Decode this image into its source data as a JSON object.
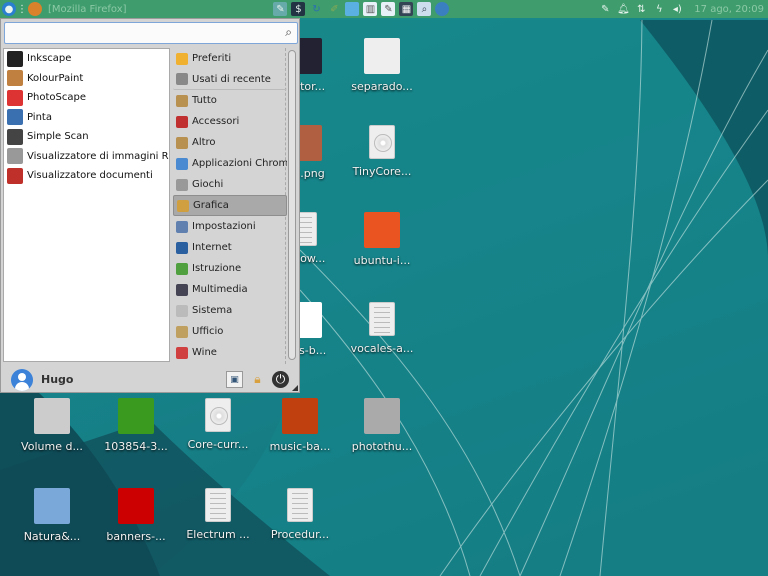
{
  "taskbar": {
    "window_title": "[Mozilla Firefox]",
    "launchers": [
      "menu-icon",
      "firefox-icon",
      "text-editor-icon",
      "terminal-icon",
      "refresh-icon",
      "brush-icon",
      "window-icon",
      "spreadsheet-icon",
      "notes-icon",
      "calculator-icon",
      "search-files-icon",
      "thunderbird-icon"
    ],
    "tray": [
      "notes-icon",
      "bell-icon",
      "network-icon",
      "power-icon",
      "volume-icon"
    ],
    "clock": "17 ago, 20:09"
  },
  "menu": {
    "search_placeholder": "",
    "apps": [
      {
        "label": "Inkscape",
        "color": "#222"
      },
      {
        "label": "KolourPaint",
        "color": "#c08040"
      },
      {
        "label": "PhotoScape",
        "color": "#d33"
      },
      {
        "label": "Pinta",
        "color": "#3a6fb0"
      },
      {
        "label": "Simple Scan",
        "color": "#444"
      },
      {
        "label": "Visualizzatore di immagini Ris...",
        "color": "#999"
      },
      {
        "label": "Visualizzatore documenti",
        "color": "#c0302a"
      }
    ],
    "categories": [
      {
        "label": "Preferiti",
        "color": "#f0b030"
      },
      {
        "label": "Usati di recente",
        "color": "#888"
      },
      {
        "label": "Tutto",
        "color": "#b89050"
      },
      {
        "label": "Accessori",
        "color": "#c03030"
      },
      {
        "label": "Altro",
        "color": "#b89050"
      },
      {
        "label": "Applicazioni Chromium",
        "color": "#4a8ad0"
      },
      {
        "label": "Giochi",
        "color": "#999"
      },
      {
        "label": "Grafica",
        "color": "#d0a040"
      },
      {
        "label": "Impostazioni",
        "color": "#6080b0"
      },
      {
        "label": "Internet",
        "color": "#2a5fa0"
      },
      {
        "label": "Istruzione",
        "color": "#50a040"
      },
      {
        "label": "Multimedia",
        "color": "#445"
      },
      {
        "label": "Sistema",
        "color": "#bbb"
      },
      {
        "label": "Ufficio",
        "color": "#c0a060"
      },
      {
        "label": "Wine",
        "color": "#d04040"
      }
    ],
    "selected_category": "Grafica",
    "user": "Hugo"
  },
  "desktop": {
    "icons": [
      {
        "label": "...ator...",
        "color": "#223"
      },
      {
        "label": "separado...",
        "color": "#eee"
      },
      {
        "label": "...x.png",
        "color": "#b06040"
      },
      {
        "label": "TinyCore...",
        "color": "cd"
      },
      {
        "label": "...dow...",
        "color": "doc"
      },
      {
        "label": "ubuntu-i...",
        "color": "#e95420"
      },
      {
        "label": "...es-b...",
        "color": "#fff"
      },
      {
        "label": "vocales-a...",
        "color": "doc"
      },
      {
        "label": "Volume d...",
        "color": "#ccc"
      },
      {
        "label": "103854-3...",
        "color": "#3a9a20"
      },
      {
        "label": "Core-curr...",
        "color": "cd"
      },
      {
        "label": "music-ba...",
        "color": "#c04010"
      },
      {
        "label": "photothu...",
        "color": "#aaa"
      },
      {
        "label": "Natura&...",
        "color": "#7aa8d8"
      },
      {
        "label": "banners-...",
        "color": "#c00"
      },
      {
        "label": "Electrum ...",
        "color": "doc"
      },
      {
        "label": "Procedur...",
        "color": "doc"
      }
    ]
  }
}
